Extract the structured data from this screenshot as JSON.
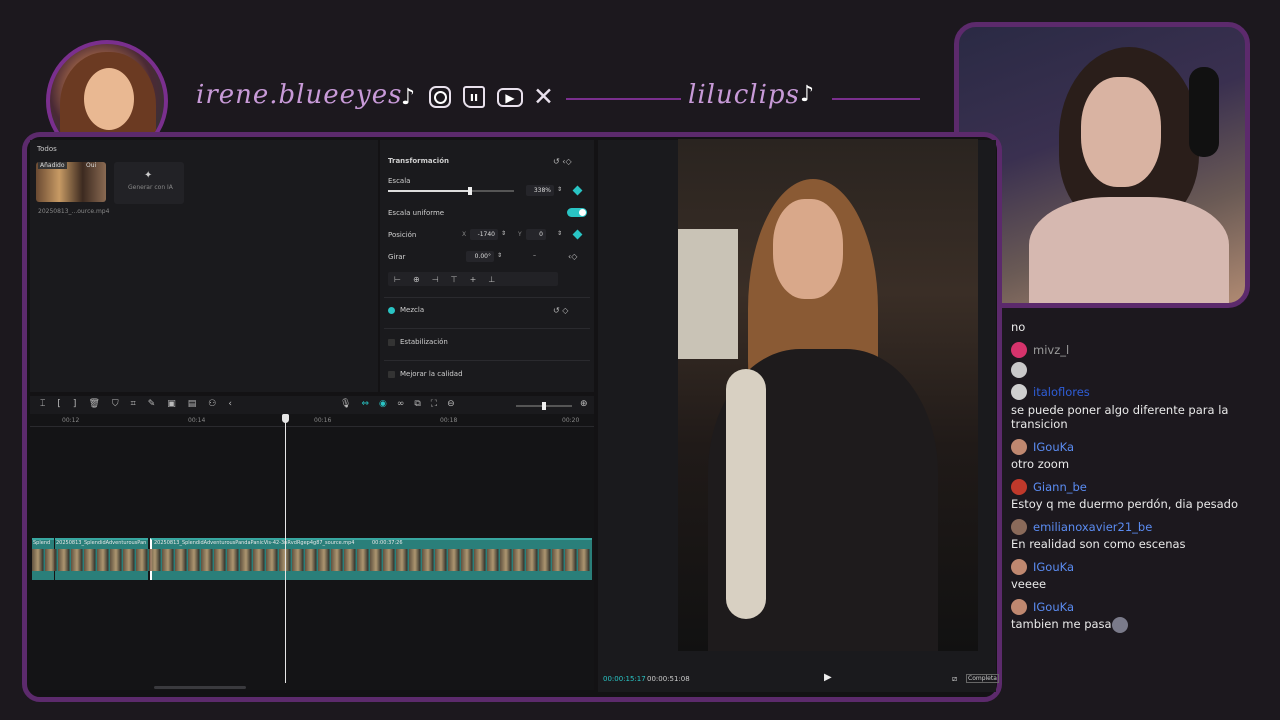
{
  "header": {
    "handle_primary": "irene.blueeyes",
    "handle_secondary": "liluclips",
    "social_icons": [
      "tiktok-icon",
      "instagram-icon",
      "twitch-icon",
      "youtube-icon",
      "x-icon"
    ]
  },
  "media": {
    "tab_all": "Todos",
    "thumb_badge_added": "Añadido",
    "thumb_badge_other": "Oui",
    "thumb_filename": "20250813_...ource.mp4",
    "generate_label": "Generar con IA"
  },
  "inspector": {
    "transform_label": "Transformación",
    "scale_label": "Escala",
    "scale_value": "338%",
    "scale_fraction": 0.65,
    "uniform_label": "Escala uniforme",
    "position_label": "Posición",
    "pos_x_label": "X",
    "pos_x_value": "-1740",
    "pos_y_label": "Y",
    "pos_y_value": "0",
    "rotate_label": "Girar",
    "rotate_value": "0.00°",
    "rotate_dash": "–",
    "blend_label": "Mezcla",
    "stabilize_label": "Estabilización",
    "quality_label": "Mejorar la calidad"
  },
  "timeline": {
    "ruler": [
      "00:12",
      "00:14",
      "00:16",
      "00:18",
      "00:20"
    ],
    "clip_a_label": "Splend",
    "clip_b_label": "20250813_SplendidAdventurousPan",
    "clip_c_label": "20250813_SplendidAdventurousPandaPanicVis-42-3nRvdRgep4g87_source.mp4",
    "clip_c_duration": "00:00:37:26",
    "zoom_fraction": 0.5
  },
  "player": {
    "current_time": "00:00:15:17",
    "total_time": "00:00:51:08",
    "complete_label": "Completa"
  },
  "chat": [
    {
      "user": "",
      "message": "no",
      "color": "#eaeaea"
    },
    {
      "user": "mivz_l",
      "message": "",
      "color": "#9a9a9a"
    },
    {
      "user": "",
      "message": "",
      "color": "#eaeaea"
    },
    {
      "user": "italoflores",
      "message": "se puede poner algo diferente para la transicion",
      "color": "#2f5ed8"
    },
    {
      "user": "IGouKa",
      "message": "otro zoom",
      "color": "#5b8cf2"
    },
    {
      "user": "Giann_be",
      "message": "Estoy q me duermo perdón, dia pesado",
      "color": "#5b8cf2"
    },
    {
      "user": "emilianoxavier21_be",
      "message": "En realidad son como escenas",
      "color": "#5b8cf2"
    },
    {
      "user": "IGouKa",
      "message": "veeee",
      "color": "#5b8cf2"
    },
    {
      "user": "IGouKa",
      "message": "tambien me pasa",
      "color": "#5b8cf2"
    }
  ],
  "colors": {
    "accent": "#5c2a6c",
    "teal": "#29c4c4",
    "chat_link": "#5b8cf2"
  }
}
